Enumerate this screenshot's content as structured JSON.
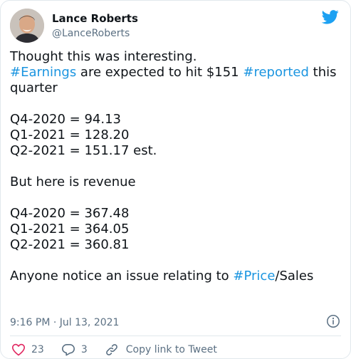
{
  "author": {
    "name": "Lance Roberts",
    "handle": "@LanceRoberts"
  },
  "tweet": {
    "line1": "Thought this was interesting.",
    "line2_tag1": "#Earnings",
    "line2_text1": " are expected to hit $151 ",
    "line2_tag2": "#reported",
    "line2_text2": " this",
    "line3": "quarter",
    "earnings": [
      "Q4-2020 = 94.13",
      "Q1-2021 = 128.20",
      "Q2-2021 = 151.17 est."
    ],
    "revenue_intro": "But here is revenue",
    "revenue": [
      "Q4-2020 = 367.48",
      "Q1-2021 = 364.05",
      "Q2-2021 = 360.81"
    ],
    "closing_text1": "Anyone notice an issue relating to ",
    "closing_tag": "#Price",
    "closing_text2": "/Sales"
  },
  "timestamp": "9:16 PM · Jul 13, 2021",
  "actions": {
    "likes": "23",
    "replies": "3",
    "copy_link": "Copy link to Tweet"
  },
  "colors": {
    "link": "#1b95e0",
    "muted": "#5b7083",
    "twitter_blue": "#1da1f2",
    "like_red": "#e0245e"
  }
}
